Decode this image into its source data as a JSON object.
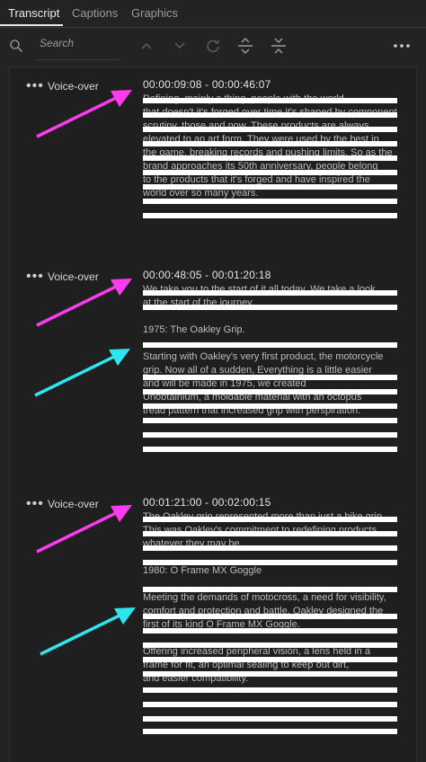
{
  "tabs": [
    {
      "label": "Transcript",
      "active": true
    },
    {
      "label": "Captions",
      "active": false
    },
    {
      "label": "Graphics",
      "active": false
    }
  ],
  "toolbar": {
    "search_placeholder": "Search",
    "icons": [
      "search-icon",
      "chevron-up-icon",
      "chevron-down-icon",
      "refresh-icon",
      "expand-icon",
      "collapse-icon",
      "more-icon"
    ]
  },
  "colors": {
    "magenta": "#ff3bf2",
    "cyan": "#2fe6f0",
    "background": "#232323",
    "panel": "#1f1f1f"
  },
  "segments": [
    {
      "menu": "•••",
      "speaker": "Voice-over",
      "time": "00:00:09:08 - 00:00:46:07",
      "text": "Defining, mainly a thing, people with the world,\nthat doesn't it's forged over time it's shaped by component\nscrutiny, those and now. These products are always\nelevated to an art form. They were used by the best in\nthe game, breaking records and pushing limits. So as the\nbrand approaches its 50th anniversary, people belong\nto the products that it's forged and have inspired the\nworld over so many years."
    },
    {
      "menu": "•••",
      "speaker": "Voice-over",
      "time": "00:00:48:05 - 00:01:20:18",
      "text": "We take you to the start of it all today. We take a look\nat the start of the journey.\n\n1975: The Oakley Grip.\n\nStarting with Oakley's very first product, the motorcycle\ngrip. Now all of a sudden, Everything is a little easier\nand will be made in 1975, we created\nUnobtainium, a moldable material with an octopus\ntread pattern that increased grip with perspiration."
    },
    {
      "menu": "•••",
      "speaker": "Voice-over",
      "time": "00:01:21:00 - 00:02:00:15",
      "text": "The Oakley grip represented more than just a bike grip.\nThis was Oakley's commitment to redefining products,\nwhatever they may be.\n\n1980: O Frame MX Goggle\n\nMeeting the demands of motocross, a need for visibility,\ncomfort and protection and battle, Oakley designed the\nfirst of its kind O Frame MX Goggle.\n\nOffering increased peripheral vision, a lens held in a\nframe for fit, an optimal sealing to keep out dirt,\nand easier compatibility."
    }
  ]
}
